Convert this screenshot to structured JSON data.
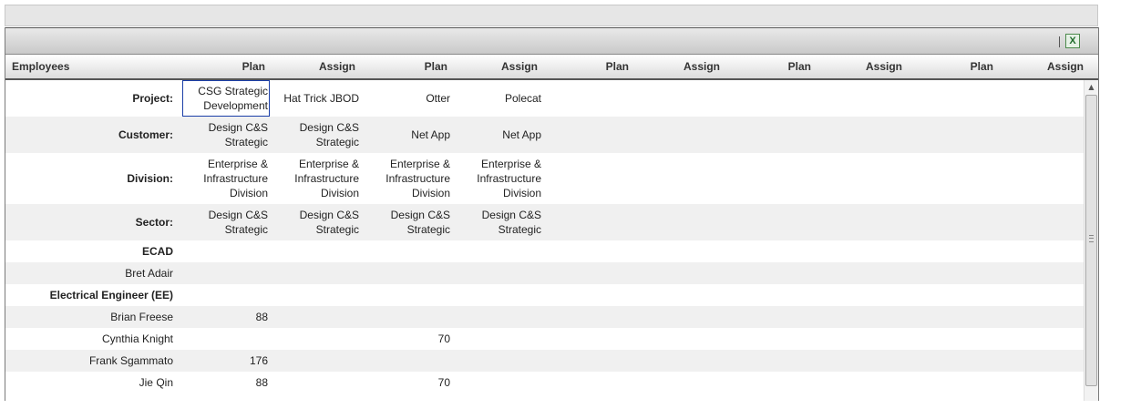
{
  "toolbar": {
    "excel_icon": "X"
  },
  "header": {
    "employees_label": "Employees",
    "columns": [
      "Plan",
      "Assign",
      "Plan",
      "Assign",
      "Plan",
      "Assign",
      "Plan",
      "Assign",
      "Plan",
      "Assign"
    ]
  },
  "meta_rows": [
    {
      "label": "Project:",
      "values": [
        "CSG Strategic\nDevelopment",
        "Hat Trick JBOD",
        "Otter",
        "Polecat"
      ]
    },
    {
      "label": "Customer:",
      "values": [
        "Design C&S\nStrategic",
        "Design C&S\nStrategic",
        "Net App",
        "Net App"
      ]
    },
    {
      "label": "Division:",
      "values": [
        "Enterprise &\nInfrastructure\nDivision",
        "Enterprise &\nInfrastructure\nDivision",
        "Enterprise &\nInfrastructure\nDivision",
        "Enterprise &\nInfrastructure\nDivision"
      ]
    },
    {
      "label": "Sector:",
      "values": [
        "Design C&S\nStrategic",
        "Design C&S\nStrategic",
        "Design C&S\nStrategic",
        "Design C&S\nStrategic"
      ]
    }
  ],
  "employee_rows": [
    {
      "label": "ECAD",
      "group": true,
      "values": [
        "",
        "",
        "",
        ""
      ]
    },
    {
      "label": "Bret Adair",
      "group": false,
      "values": [
        "",
        "",
        "",
        ""
      ]
    },
    {
      "label": "Electrical Engineer (EE)",
      "group": true,
      "values": [
        "",
        "",
        "",
        ""
      ]
    },
    {
      "label": "Brian Freese",
      "group": false,
      "values": [
        "88",
        "",
        "",
        ""
      ]
    },
    {
      "label": "Cynthia Knight",
      "group": false,
      "values": [
        "",
        "",
        "70",
        ""
      ]
    },
    {
      "label": "Frank Sgammato",
      "group": false,
      "values": [
        "176",
        "",
        "",
        ""
      ]
    },
    {
      "label": "Jie Qin",
      "group": false,
      "values": [
        "88",
        "",
        "70",
        ""
      ]
    }
  ]
}
